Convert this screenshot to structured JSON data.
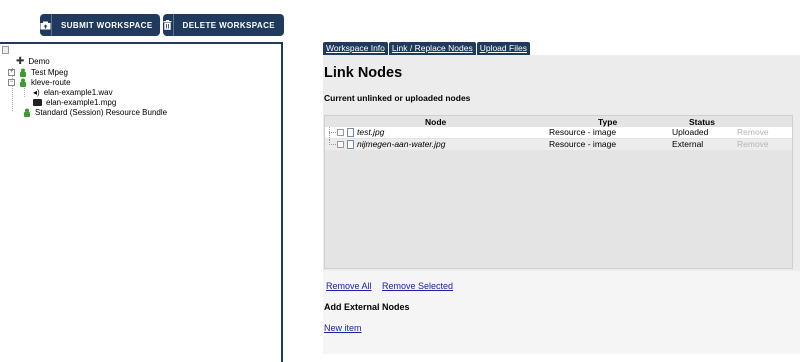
{
  "toolbar": {
    "submit_label": "SUBMIT WORKSPACE",
    "delete_label": "DELETE WORKSPACE"
  },
  "tree": {
    "root": "Demo",
    "items": [
      {
        "label": "Test Mpeg"
      },
      {
        "label": "kleve-route"
      },
      {
        "label": "elan-example1.wav"
      },
      {
        "label": "elan-example1.mpg"
      },
      {
        "label": "Standard (Session) Resource Bundle"
      }
    ]
  },
  "tabs": [
    "Workspace Info",
    "Link / Replace Nodes",
    "Upload Files"
  ],
  "main": {
    "title": "Link Nodes",
    "subtitle": "Current unlinked or uploaded nodes",
    "columns": [
      "Node",
      "Type",
      "Status"
    ],
    "rows": [
      {
        "node": "test.jpg",
        "type": "Resource - image",
        "status": "Uploaded",
        "action": "Remove"
      },
      {
        "node": "nijmegen-aan-water.jpg",
        "type": "Resource - image",
        "status": "External",
        "action": "Remove"
      }
    ],
    "remove_all": "Remove All",
    "remove_selected": "Remove Selected",
    "add_external": "Add External Nodes",
    "new_item": "New item"
  },
  "colors": {
    "accent": "#1f3a5c",
    "panel": "#ececec",
    "link": "#1a23a8"
  }
}
